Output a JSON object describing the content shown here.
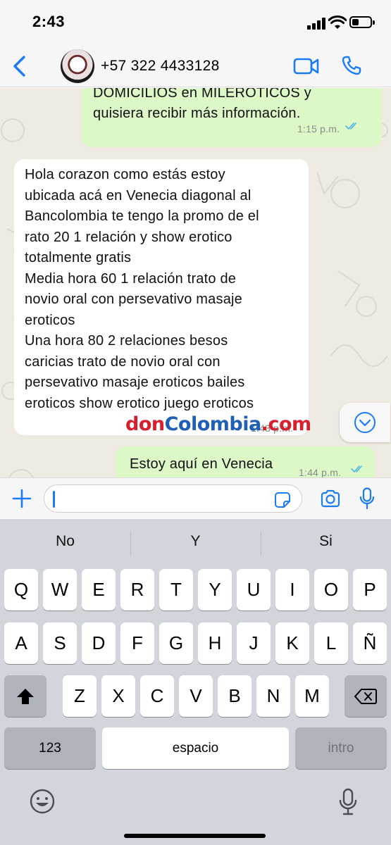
{
  "status_bar": {
    "time": "2:43"
  },
  "header": {
    "contact": "+57 322 4433128",
    "back_icon": "chevron-left-icon",
    "video_icon": "video-camera-icon",
    "call_icon": "phone-icon"
  },
  "messages": [
    {
      "direction": "outgoing",
      "lines": [
        "DOMICILIOS en MILEROTICOS y",
        "quisiera recibir más información."
      ],
      "time": "1:15 p.m.",
      "read": true
    },
    {
      "direction": "incoming",
      "lines": [
        "Hola corazon como estás estoy",
        "ubicada acá en Venecia diagonal al",
        "Bancolombia te tengo la promo de el",
        "rato 20 1 relación y show erotico",
        "totalmente gratis",
        "Media hora 60 1 relación trato de",
        "novio oral con persevativo masaje",
        "eroticos",
        "Una hora 80 2 relaciones besos",
        "caricias trato de novio oral con",
        "persevativo masaje eroticos bailes",
        "eroticos show erotico juego eroticos"
      ],
      "time": "1:43 p.m."
    },
    {
      "direction": "outgoing",
      "lines": [
        "Estoy aquí en Venecia"
      ],
      "time": "1:44 p.m.",
      "read": true
    }
  ],
  "watermark": {
    "part1": "don",
    "part2": "Colombia",
    "part3": ".com"
  },
  "input": {
    "value": "",
    "placeholder": ""
  },
  "keyboard": {
    "suggestions": [
      "No",
      "Y",
      "Si"
    ],
    "row1": [
      "Q",
      "W",
      "E",
      "R",
      "T",
      "Y",
      "U",
      "I",
      "O",
      "P"
    ],
    "row2": [
      "A",
      "S",
      "D",
      "F",
      "G",
      "H",
      "J",
      "K",
      "L",
      "Ñ"
    ],
    "row3": [
      "Z",
      "X",
      "C",
      "V",
      "B",
      "N",
      "M"
    ],
    "numbers_label": "123",
    "space_label": "espacio",
    "return_label": "intro"
  },
  "colors": {
    "ios_blue": "#1a7cf5",
    "outgoing_bubble": "#dcf8c6",
    "read_ticks": "#4fb3e8"
  }
}
